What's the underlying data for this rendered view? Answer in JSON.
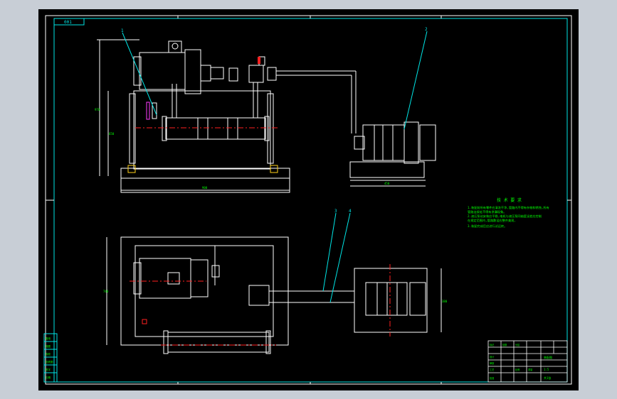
{
  "drawing": {
    "corner_label": "001",
    "callouts": [
      "1",
      "2",
      "3",
      "4"
    ],
    "dimensions": {
      "top_width": "900",
      "top_height_outer": "970",
      "top_height_inner": "650",
      "winch_width": "450",
      "plan_depth": "740",
      "winch_depth": "380"
    },
    "tech_title": "技 术 要 求",
    "tech_lines": [
      "1.装配前所有零件应清洗干净,管路内不得有杂物和锈蚀,所有",
      "  管路连接处不得有渗漏现象。",
      "2.液压泵站安装应平稳,电机与液压泵同轴度误差应控制",
      "  在规定范围内,管路敷设应整齐美观,",
      "3.装配完成后应进行试运转。"
    ],
    "title_block": {
      "drawing_name": "装配图",
      "scale": "1:5",
      "sheet": "共1张",
      "cells": [
        "标记",
        "处数",
        "分区",
        "设计",
        "审核",
        "工艺",
        "批准",
        "比例",
        "重量"
      ]
    },
    "side_strip": [
      "借用",
      "描图",
      "描校",
      "旧底图",
      "签字",
      "日期"
    ]
  },
  "colors": {
    "background": "#000000",
    "frame": "#ffffff",
    "border_cyan": "#00e5e5",
    "lines": "#ffffff",
    "centerline": "#ff2020",
    "text_green": "#00ff00",
    "accent_yellow": "#ffd21a",
    "tank_magenta": "#ff3cff"
  }
}
